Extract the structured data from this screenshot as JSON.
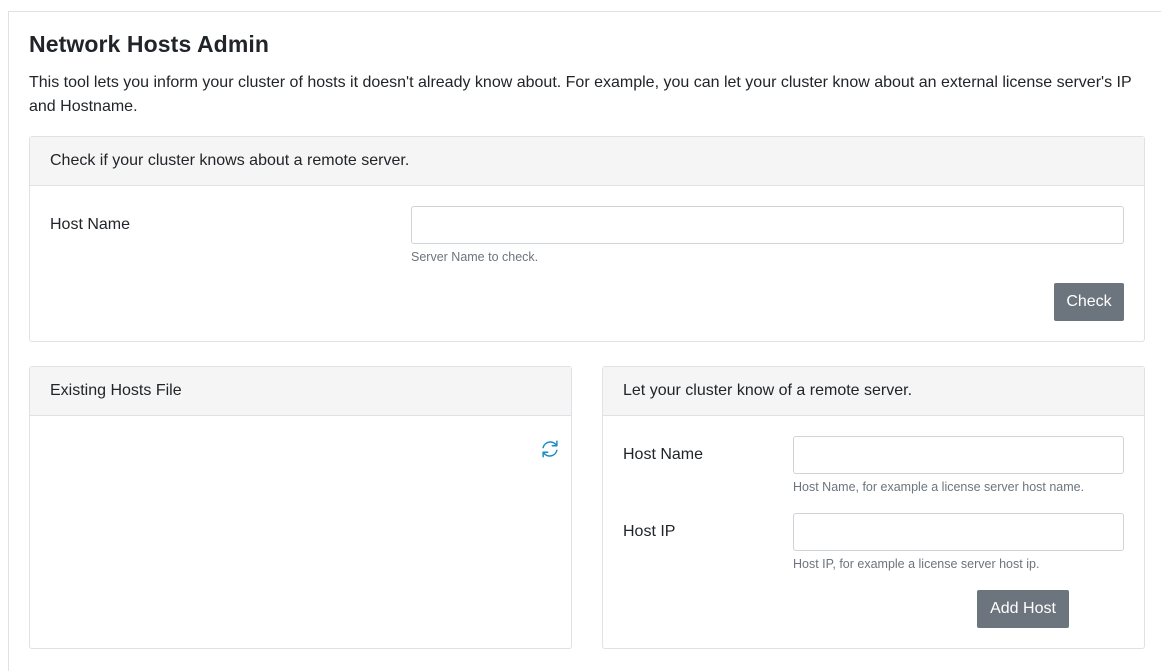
{
  "page": {
    "title": "Network Hosts Admin",
    "intro": "This tool lets you inform your cluster of hosts it doesn't already know about. For example, you can let your cluster know about an external license server's IP and Hostname."
  },
  "check_card": {
    "header": "Check if your cluster knows about a remote server.",
    "host_label": "Host Name",
    "host_value": "",
    "host_help": "Server Name to check.",
    "check_button": "Check"
  },
  "hosts_file_card": {
    "header": "Existing Hosts File",
    "refresh_icon": "refresh-icon",
    "content": ""
  },
  "add_card": {
    "header": "Let your cluster know of a remote server.",
    "host_name_label": "Host Name",
    "host_name_value": "",
    "host_name_help": "Host Name, for example a license server host name.",
    "host_ip_label": "Host IP",
    "host_ip_value": "",
    "host_ip_help": "Host IP, for example a license server host ip.",
    "add_button": "Add Host"
  },
  "colors": {
    "button_bg": "#6c757d",
    "header_bg": "#f5f5f5",
    "border": "#dee2e6",
    "help_text": "#6c757d",
    "icon": "#1a8bc4"
  }
}
